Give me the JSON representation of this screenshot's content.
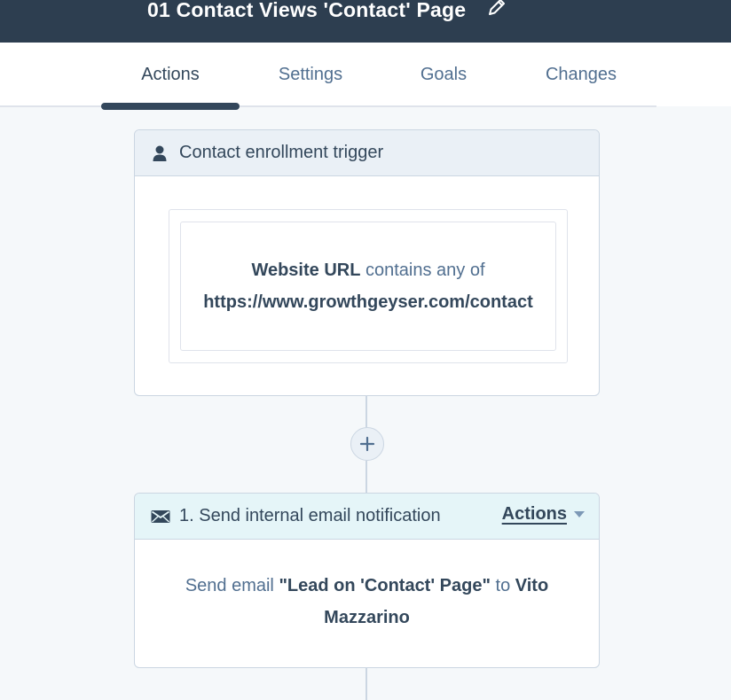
{
  "header": {
    "workflow_title": "01 Contact Views 'Contact' Page",
    "edit_icon": "pencil-icon"
  },
  "tabs": [
    {
      "label": "Actions",
      "active": true
    },
    {
      "label": "Settings",
      "active": false
    },
    {
      "label": "Goals",
      "active": false
    },
    {
      "label": "Changes",
      "active": false
    }
  ],
  "trigger": {
    "icon": "person-icon",
    "title": "Contact enrollment trigger",
    "filter": {
      "property": "Website URL",
      "operator": "contains any of",
      "value": "https://www.growthgeyser.com/contact"
    }
  },
  "add_action": {
    "icon": "plus-icon"
  },
  "action": {
    "icon": "envelope-icon",
    "title": "1. Send internal email notification",
    "menu_label": "Actions",
    "menu_icon": "caret-down-icon",
    "body_prefix": "Send email",
    "email_name": "\"Lead on 'Contact' Page\"",
    "connector_word": "to",
    "recipient": "Vito Mazzarino"
  },
  "colors": {
    "header_bg": "#2d3e50",
    "page_bg": "#f5f8fa",
    "text": "#33475b",
    "trigger_header_bg": "#eaf0f6",
    "action_header_bg": "#e5f5f8"
  }
}
